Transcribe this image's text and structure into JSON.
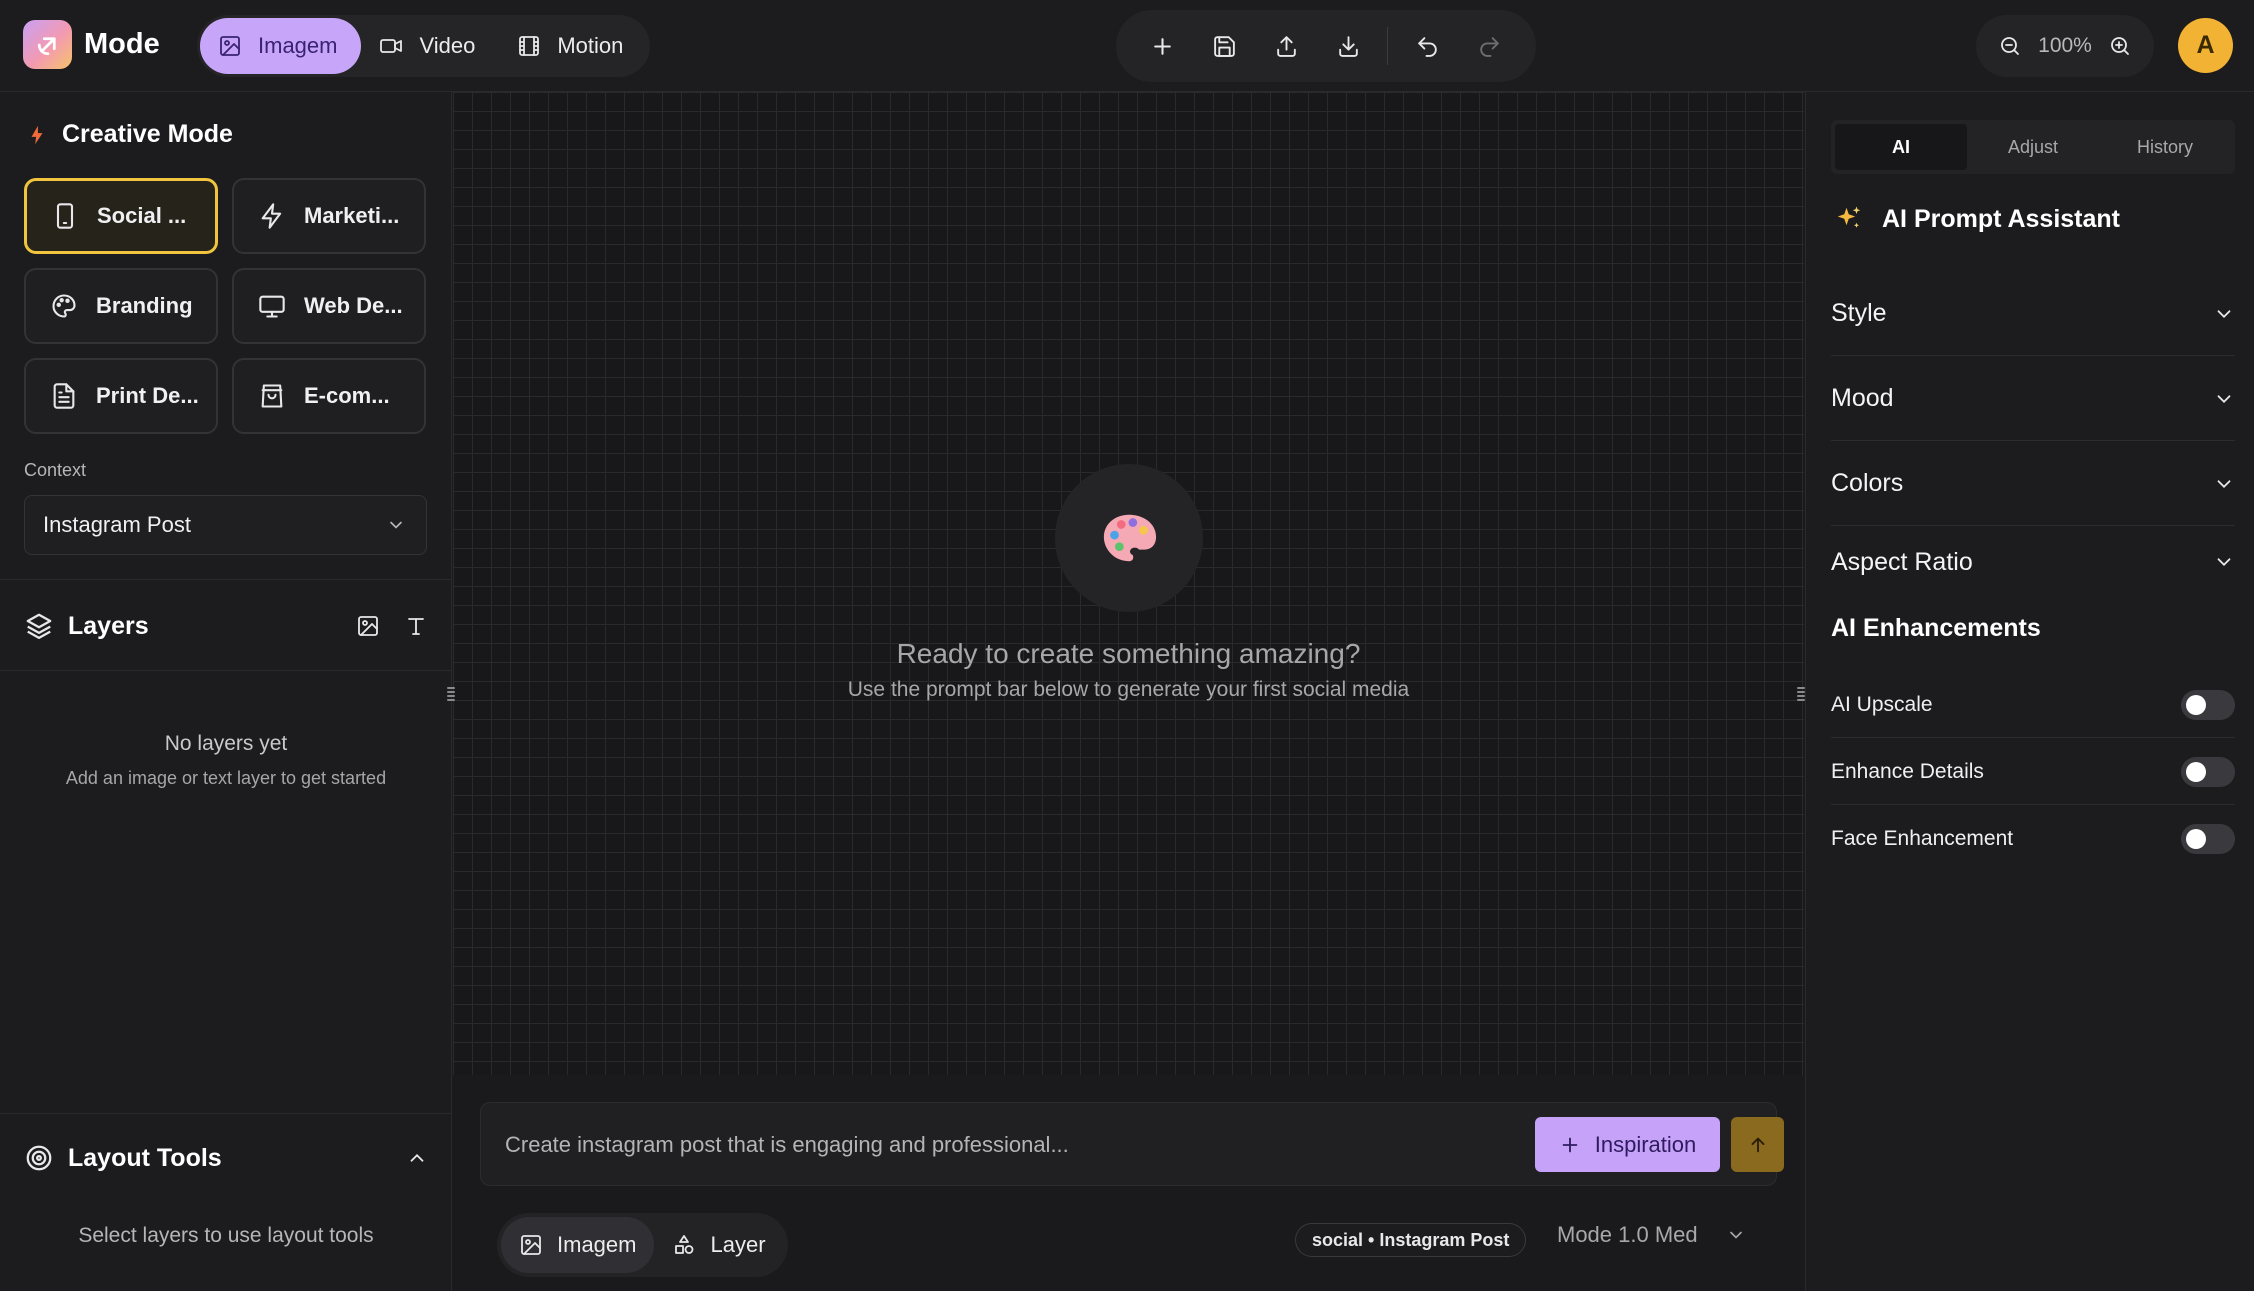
{
  "app": {
    "name": "Mode"
  },
  "mode_tabs": [
    {
      "label": "Imagem",
      "icon": "image-icon",
      "active": true
    },
    {
      "label": "Video",
      "icon": "video-icon",
      "active": false
    },
    {
      "label": "Motion",
      "icon": "film-icon",
      "active": false
    }
  ],
  "toolbar": {
    "icons": [
      "plus-icon",
      "save-icon",
      "upload-icon",
      "download-icon",
      "undo-icon",
      "redo-icon"
    ],
    "zoom": "100%"
  },
  "user": {
    "initial": "A"
  },
  "creative_mode": {
    "title": "Creative Mode",
    "cards": [
      {
        "label": "Social ...",
        "icon": "smartphone-icon",
        "active": true
      },
      {
        "label": "Marketi...",
        "icon": "bolt-icon",
        "active": false
      },
      {
        "label": "Branding",
        "icon": "palette-icon",
        "active": false
      },
      {
        "label": "Web De...",
        "icon": "monitor-icon",
        "active": false
      },
      {
        "label": "Print De...",
        "icon": "document-icon",
        "active": false
      },
      {
        "label": "E-com...",
        "icon": "shopping-bag-icon",
        "active": false
      }
    ]
  },
  "context": {
    "label": "Context",
    "value": "Instagram Post"
  },
  "layers": {
    "title": "Layers",
    "empty_title": "No layers yet",
    "empty_subtitle": "Add an image or text layer to get started"
  },
  "layout_tools": {
    "title": "Layout Tools",
    "hint": "Select layers to use layout tools"
  },
  "canvas": {
    "empty_title": "Ready to create something amazing?",
    "empty_subtitle": "Use the prompt bar below to generate your first social media"
  },
  "prompt": {
    "placeholder": "Create instagram post that is engaging and professional...",
    "inspiration_label": "Inspiration",
    "tabs": [
      {
        "label": "Imagem",
        "icon": "image-icon",
        "active": true
      },
      {
        "label": "Layer",
        "icon": "shapes-icon",
        "active": false
      }
    ],
    "status": "social • Instagram Post",
    "model": "Mode 1.0 Med"
  },
  "right_panel": {
    "tabs": [
      {
        "label": "AI",
        "active": true
      },
      {
        "label": "Adjust",
        "active": false
      },
      {
        "label": "History",
        "active": false
      }
    ],
    "assistant_title": "AI Prompt Assistant",
    "accordions": [
      "Style",
      "Mood",
      "Colors",
      "Aspect Ratio"
    ],
    "enhancements_title": "AI Enhancements",
    "toggles": [
      {
        "label": "AI Upscale",
        "on": false
      },
      {
        "label": "Enhance Details",
        "on": false
      },
      {
        "label": "Face Enhancement",
        "on": false
      }
    ]
  },
  "colors": {
    "accent_purple": "#c7a6f9",
    "accent_yellow": "#f0c43e",
    "send_button": "#8a6a1e",
    "avatar": "#f2b233",
    "background": "#1a1a1c"
  }
}
